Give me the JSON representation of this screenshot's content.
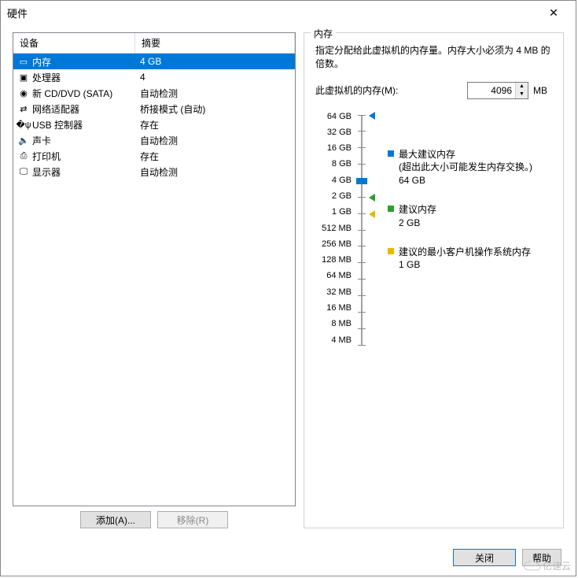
{
  "dialog": {
    "title": "硬件"
  },
  "table": {
    "headers": {
      "device": "设备",
      "summary": "摘要"
    },
    "rows": [
      {
        "icon": "memory-icon",
        "device": "内存",
        "summary": "4 GB",
        "selected": true
      },
      {
        "icon": "cpu-icon",
        "device": "处理器",
        "summary": "4",
        "selected": false
      },
      {
        "icon": "cd-icon",
        "device": "新 CD/DVD (SATA)",
        "summary": "自动检测",
        "selected": false
      },
      {
        "icon": "nic-icon",
        "device": "网络适配器",
        "summary": "桥接模式 (自动)",
        "selected": false
      },
      {
        "icon": "usb-icon",
        "device": "USB 控制器",
        "summary": "存在",
        "selected": false
      },
      {
        "icon": "sound-icon",
        "device": "声卡",
        "summary": "自动检测",
        "selected": false
      },
      {
        "icon": "printer-icon",
        "device": "打印机",
        "summary": "存在",
        "selected": false
      },
      {
        "icon": "display-icon",
        "device": "显示器",
        "summary": "自动检测",
        "selected": false
      }
    ]
  },
  "buttons": {
    "add": "添加(A)...",
    "remove": "移除(R)",
    "close": "关闭",
    "help": "帮助"
  },
  "memory": {
    "group_title": "内存",
    "description": "指定分配给此虚拟机的内存量。内存大小必须为 4 MB 的倍数。",
    "field_label": "此虚拟机的内存(M):",
    "value": "4096",
    "unit": "MB",
    "ticks": [
      "64 GB",
      "32 GB",
      "16 GB",
      "8 GB",
      "4 GB",
      "2 GB",
      "1 GB",
      "512 MB",
      "256 MB",
      "128 MB",
      "64 MB",
      "32 MB",
      "16 MB",
      "8 MB",
      "4 MB"
    ],
    "pointers": {
      "max": {
        "color": "#0078d7",
        "tick_index": 0
      },
      "rec": {
        "color": "#2aa02a",
        "tick_index": 5
      },
      "min": {
        "color": "#e6b800",
        "tick_index": 6
      }
    },
    "thumb_tick_index": 4,
    "legend": {
      "max_title": "最大建议内存",
      "max_note": "(超出此大小可能发生内存交换。)",
      "max_value": "64 GB",
      "rec_title": "建议内存",
      "rec_value": "2 GB",
      "min_title": "建议的最小客户机操作系统内存",
      "min_value": "1 GB"
    }
  },
  "watermark": "亿速云"
}
